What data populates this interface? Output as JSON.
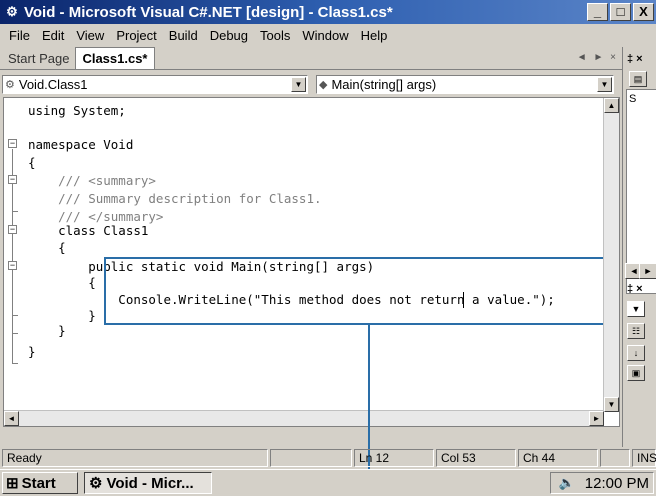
{
  "window": {
    "title": "Void - Microsoft Visual C#.NET [design] - Class1.cs*",
    "minimize": "_",
    "maximize": "□",
    "close": "X"
  },
  "menu": [
    "File",
    "Edit",
    "View",
    "Project",
    "Build",
    "Debug",
    "Tools",
    "Window",
    "Help"
  ],
  "tabs": [
    {
      "label": "Start Page",
      "active": false
    },
    {
      "label": "Class1.cs*",
      "active": true
    }
  ],
  "tab_nav": "◄ ► ×",
  "type_selector": "Void.Class1",
  "member_selector": "Main(string[] args)",
  "code": [
    "using System;",
    "",
    "namespace Void",
    "{",
    "    /// <summary>",
    "    /// Summary description for Class1.",
    "    /// </summary>",
    "    class Class1",
    "    {",
    "        public static void Main(string[] args)",
    "        {",
    "            Console.WriteLine(\"This method does not return a value.\");",
    "        }",
    "    }",
    "}"
  ],
  "status": {
    "ready": "Ready",
    "line": "Ln 12",
    "col": "Col 53",
    "ch": "Ch 44",
    "mode": "INS"
  },
  "taskbar": {
    "start": "Start",
    "task": "Void - Micr...",
    "clock": "12:00 PM"
  },
  "right_panel": {
    "tree_label": "S",
    "pin": "‡ ×"
  },
  "colors": {
    "title_start": "#0a246a",
    "title_end": "#5b85c8",
    "highlight": "#2a6ea8",
    "comment": "#808080"
  }
}
